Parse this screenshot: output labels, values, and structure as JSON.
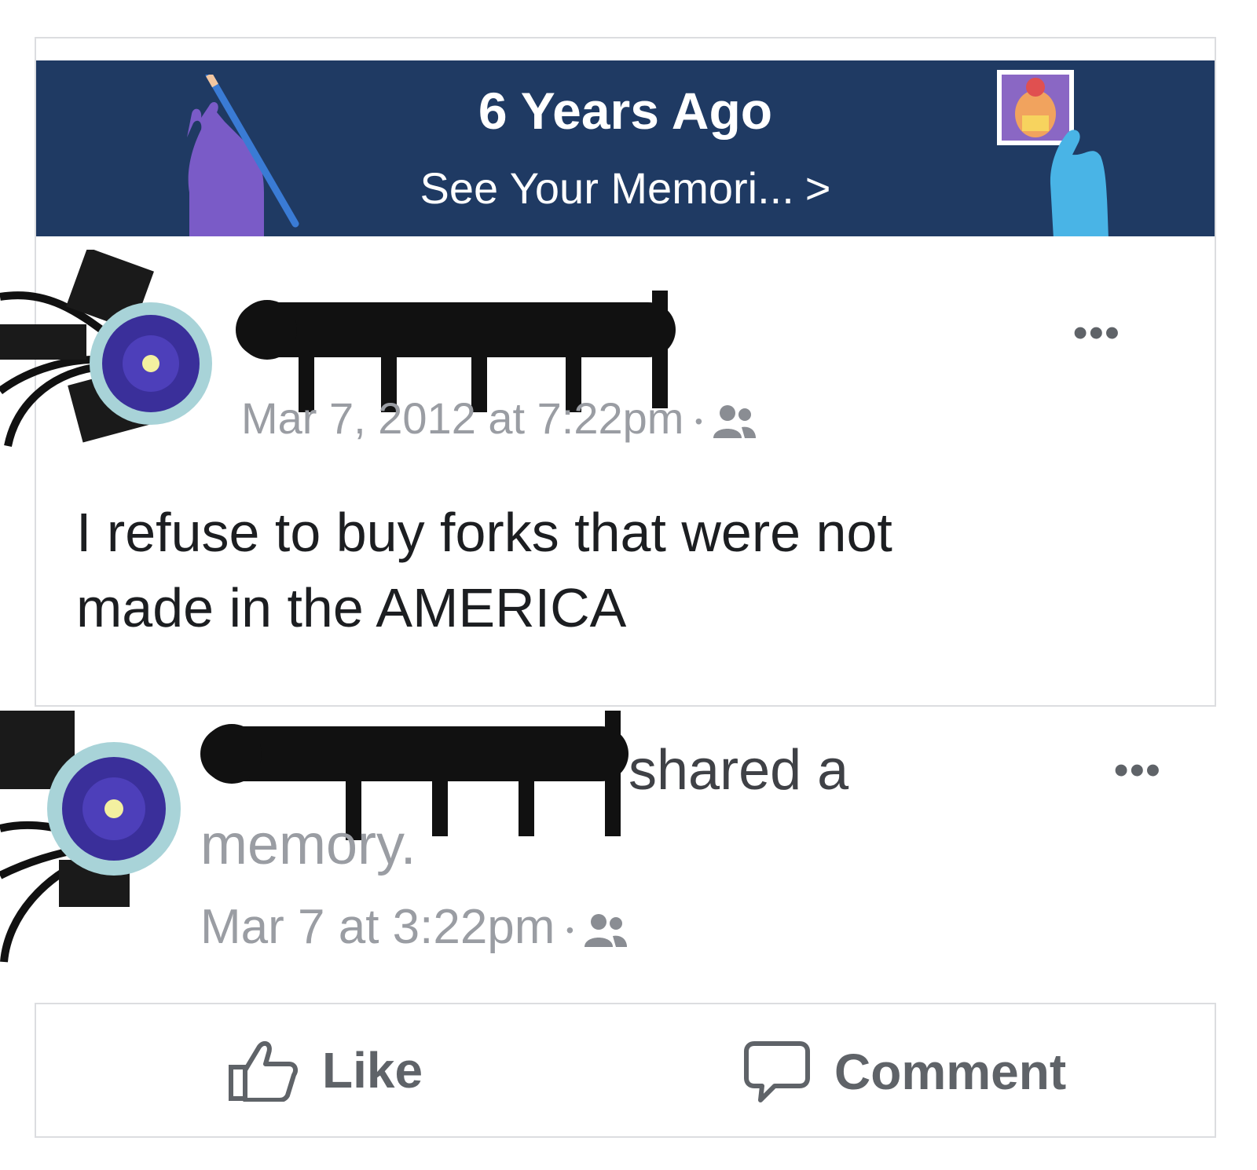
{
  "memory_banner": {
    "title": "6 Years Ago",
    "link_label": "See Your Memori...",
    "link_chevron": ">",
    "background": "#1f3a63"
  },
  "original_post": {
    "timestamp": "Mar 7, 2012 at 7:22pm",
    "separator": "•",
    "audience_icon": "friends-icon",
    "more_label": "•••",
    "text_line1": "I refuse to buy forks that were not",
    "text_line2": "made in the AMERICA"
  },
  "share_post": {
    "action_text": "shared a",
    "action_text_2": "memory.",
    "timestamp": "Mar 7 at 3:22pm",
    "separator": "•",
    "audience_icon": "friends-icon",
    "more_label": "•••"
  },
  "actions": {
    "like_label": "Like",
    "like_icon": "thumbs-up-icon",
    "comment_label": "Comment",
    "comment_icon": "comment-bubble-icon"
  }
}
